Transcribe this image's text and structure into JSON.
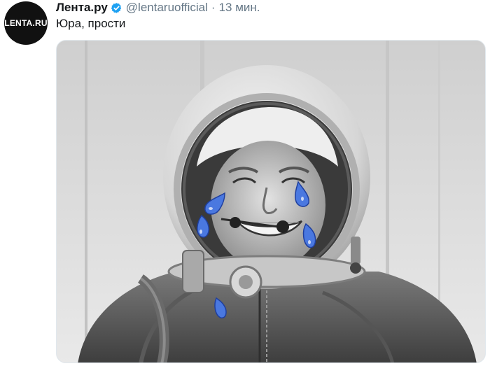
{
  "account": {
    "avatar_text": "LENTA.RU",
    "display_name": "Лента.ру",
    "handle": "@lentaruofficial",
    "separator": "·",
    "time": "13 мин.",
    "verified_icon": "verified-badge-icon"
  },
  "tweet": {
    "text": "Юра, прости"
  },
  "colors": {
    "verified": "#1da1f2",
    "tears": "#4a78e0",
    "muted": "#657786",
    "text": "#14171a"
  }
}
